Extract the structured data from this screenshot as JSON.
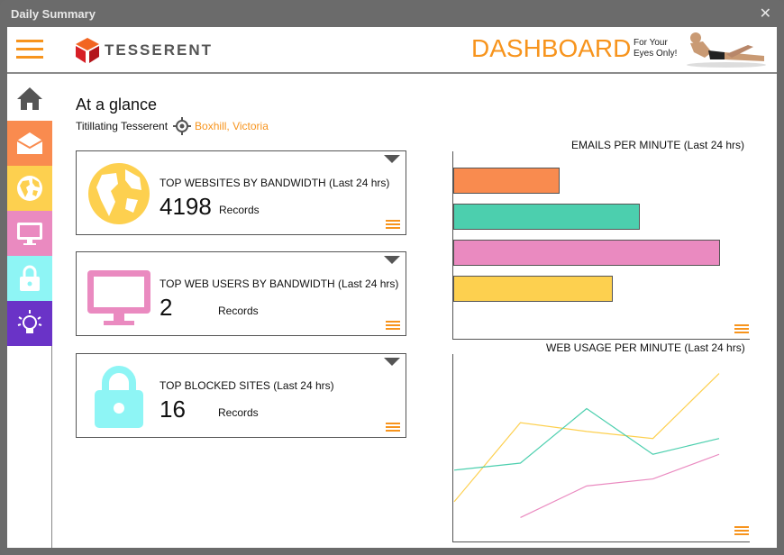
{
  "window": {
    "title": "Daily Summary",
    "close_glyph": "✕"
  },
  "header": {
    "logo_text": "TESSERENT",
    "dashboard_label": "DASHBOARD",
    "tagline_line1": "For Your",
    "tagline_line2": "Eyes Only!"
  },
  "sidebar": {
    "items": [
      {
        "name": "home",
        "icon": "home-icon",
        "color": "#ffffff"
      },
      {
        "name": "email",
        "icon": "envelope-icon",
        "color": "#f98b4f"
      },
      {
        "name": "web",
        "icon": "globe-icon",
        "color": "#fdd04f"
      },
      {
        "name": "users",
        "icon": "monitor-icon",
        "color": "#ea8ac0"
      },
      {
        "name": "security",
        "icon": "lock-icon",
        "color": "#8ef5f5"
      },
      {
        "name": "ideas",
        "icon": "lightbulb-icon",
        "color": "#6a33c7"
      }
    ]
  },
  "main": {
    "heading": "At a glance",
    "company": "Titillating Tesserent",
    "location": "Boxhill, Victoria",
    "cards": [
      {
        "title": "TOP WEBSITES BY BANDWIDTH (Last 24 hrs)",
        "count": "4198",
        "unit": "Records",
        "color": "#fdd04f",
        "icon": "globe-icon"
      },
      {
        "title": "TOP WEB USERS BY BANDWIDTH (Last 24 hrs)",
        "count": "2",
        "unit": "Records",
        "color": "#ea8ac0",
        "icon": "monitor-icon"
      },
      {
        "title": "TOP BLOCKED SITES (Last 24 hrs)",
        "count": "16",
        "unit": "Records",
        "color": "#8ef5f5",
        "icon": "lock-icon"
      }
    ]
  },
  "chart_data": [
    {
      "type": "bar",
      "orientation": "horizontal",
      "title": "EMAILS PER MINUTE (Last 24 hrs)",
      "values": [
        118,
        207,
        296,
        177
      ],
      "colors": [
        "#f98b4f",
        "#4ccfae",
        "#ea8ac0",
        "#fdd04f"
      ],
      "xlim": [
        0,
        330
      ]
    },
    {
      "type": "line",
      "title": "WEB USAGE PER MINUTE (Last 24 hrs)",
      "x": [
        0,
        1,
        2,
        3,
        4
      ],
      "ylim": [
        0,
        100
      ],
      "series": [
        {
          "color": "#fdd04f",
          "values": [
            18,
            63,
            58,
            54,
            91
          ]
        },
        {
          "color": "#4ccfae",
          "values": [
            36,
            40,
            71,
            45,
            54
          ]
        },
        {
          "color": "#ea8ac0",
          "values": [
            null,
            9,
            27,
            31,
            45
          ]
        }
      ]
    }
  ]
}
